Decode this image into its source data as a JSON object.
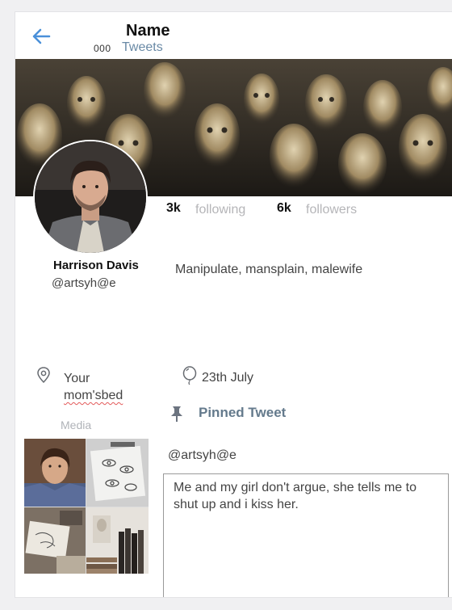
{
  "header": {
    "title": "Name",
    "tweet_count": "000",
    "tweets_label": "Tweets"
  },
  "stats": {
    "following_count": "3k",
    "following_label": "following",
    "followers_count": "6k",
    "followers_label": "followers"
  },
  "profile": {
    "display_name": "Harrison Davis",
    "handle": "@artsyh@e",
    "bio": "Manipulate, mansplain, malewife",
    "location_line1": "Your",
    "location_line2": "mom'sbed",
    "birthday": "23th July"
  },
  "media": {
    "label": "Media"
  },
  "pinned": {
    "label": "Pinned Tweet",
    "handle": "@artsyh@e",
    "text": "Me and my girl don't argue, she tells me to shut up and i kiss her."
  },
  "colors": {
    "accent_blue": "#4a90d9",
    "muted_label": "#647a8c",
    "spellcheck_red": "#e35a5a"
  },
  "icons": [
    "back-arrow-icon",
    "location-pin-icon",
    "balloon-icon",
    "pushpin-icon"
  ]
}
